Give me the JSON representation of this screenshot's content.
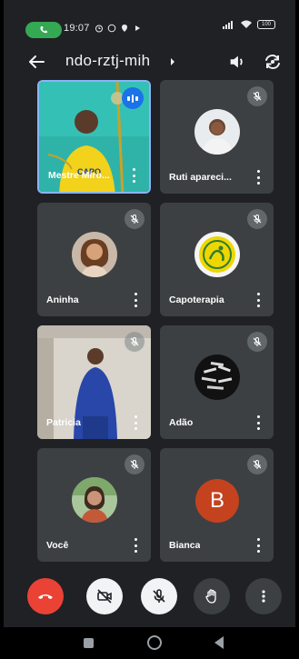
{
  "status_bar": {
    "time": "19:07",
    "battery": "100"
  },
  "meeting": {
    "title": "ndo-rztj-mih"
  },
  "participants": [
    {
      "name": "Mestre Miro...",
      "state": "speaking"
    },
    {
      "name": "Ruti apareci...",
      "state": "muted"
    },
    {
      "name": "Aninha",
      "state": "muted"
    },
    {
      "name": "Capoterapia",
      "state": "muted"
    },
    {
      "name": "Patricia",
      "state": "muted"
    },
    {
      "name": "Adão",
      "state": "muted"
    },
    {
      "name": "Você",
      "state": "muted"
    },
    {
      "name": "Bianca",
      "state": "muted",
      "initial": "B"
    }
  ],
  "colors": {
    "end_call": "#ea4335",
    "speaking": "#1a73e8",
    "bianca_avatar": "#c5421f",
    "tile": "#3c4043",
    "background": "#202124"
  },
  "icons": [
    "back-arrow",
    "chevron-right",
    "speaker",
    "switch-camera",
    "mic-off",
    "more-vert",
    "end-call",
    "camera-off",
    "raise-hand"
  ]
}
